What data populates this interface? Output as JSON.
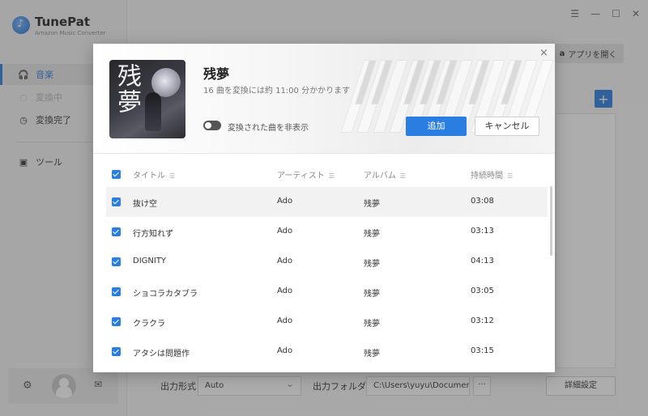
{
  "app": {
    "name": "TunePat",
    "subtitle": "Amazon Music Converter",
    "amazon_button": "アプリを開く",
    "amazon_icon_letter": "a",
    "add_icon": "+"
  },
  "sidebar": {
    "items": [
      {
        "label": "音楽",
        "icon": "headphones-icon",
        "glyph": "🎧",
        "state": "active"
      },
      {
        "label": "変換中",
        "icon": "converting-icon",
        "glyph": "◌",
        "state": "disabled"
      },
      {
        "label": "変換完了",
        "icon": "clock-icon",
        "glyph": "◷",
        "state": "normal"
      },
      {
        "label": "ツール",
        "icon": "toolbox-icon",
        "glyph": "▣",
        "state": "normal"
      }
    ]
  },
  "bottom_bar": {
    "format_label": "出力形式",
    "format_value": "Auto",
    "folder_label": "出力フォルダ",
    "folder_value": "C:\\Users\\yuyu\\Documer",
    "browse_label": "···",
    "detail_button": "詳細設定"
  },
  "dialog": {
    "album_title": "残夢",
    "cover_text": "残夢",
    "convert_info": "16 曲を変換には約 11:00 分かかります",
    "toggle_label": "変換された曲を非表示",
    "toggle_on": false,
    "add_button": "追加",
    "cancel_button": "キャンセル",
    "close_glyph": "×",
    "columns": {
      "title": "タイトル",
      "artist": "アーティスト",
      "album": "アルバム",
      "duration": "持続時間"
    },
    "tracks": [
      {
        "title": "抜け空",
        "artist": "Ado",
        "album": "残夢",
        "duration": "03:08"
      },
      {
        "title": "行方知れず",
        "artist": "Ado",
        "album": "残夢",
        "duration": "03:13"
      },
      {
        "title": "DIGNITY",
        "artist": "Ado",
        "album": "残夢",
        "duration": "04:13"
      },
      {
        "title": "ショコラカタブラ",
        "artist": "Ado",
        "album": "残夢",
        "duration": "03:05"
      },
      {
        "title": "クラクラ",
        "artist": "Ado",
        "album": "残夢",
        "duration": "03:12"
      },
      {
        "title": "アタシは問題作",
        "artist": "Ado",
        "album": "残夢",
        "duration": "03:15"
      }
    ]
  }
}
